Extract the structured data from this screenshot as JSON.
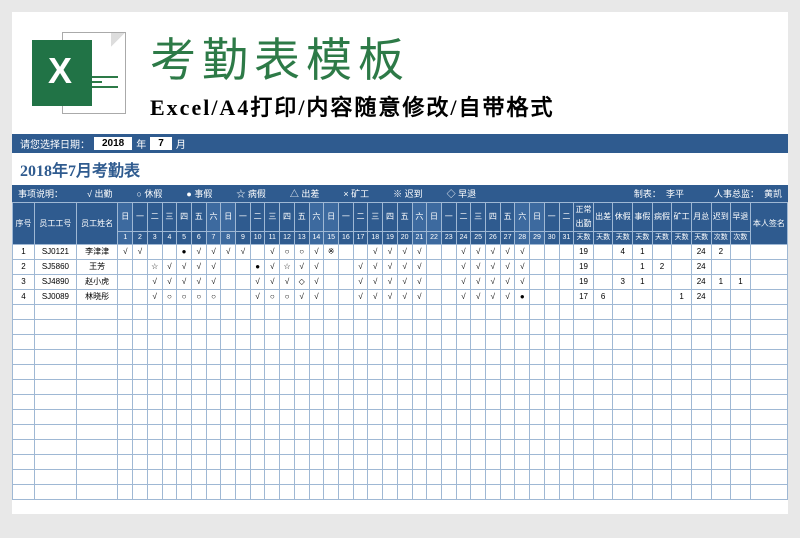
{
  "hero": {
    "big_title": "考勤表模板",
    "subtitle": "Excel/A4打印/内容随意修改/自带格式",
    "x_letter": "X"
  },
  "datebar": {
    "prompt": "请您选择日期：",
    "year": "2018",
    "year_suffix": "年",
    "month": "7",
    "month_suffix": "月"
  },
  "sheet_title": "2018年7月考勤表",
  "legend": {
    "label": "事项说明：",
    "items": [
      "√ 出勤",
      "○ 休假",
      "● 事假",
      "☆ 病假",
      "△ 出差",
      "× 矿工",
      "※ 迟到",
      "◇ 早退"
    ],
    "maker_label": "制表：",
    "maker": "李平",
    "hr_label": "人事总监：",
    "hr": "黄凯"
  },
  "headers": {
    "idx": "序号",
    "emp": "员工工号",
    "name": "员工姓名",
    "weekdays": [
      "日",
      "一",
      "二",
      "三",
      "四",
      "五",
      "六",
      "日",
      "一",
      "二",
      "三",
      "四",
      "五",
      "六",
      "日",
      "一",
      "二",
      "三",
      "四",
      "五",
      "六",
      "日",
      "一",
      "二",
      "三",
      "四",
      "五",
      "六",
      "日",
      "一",
      "二"
    ],
    "daynums": [
      "1",
      "2",
      "3",
      "4",
      "5",
      "6",
      "7",
      "8",
      "9",
      "10",
      "11",
      "12",
      "13",
      "14",
      "15",
      "16",
      "17",
      "18",
      "19",
      "20",
      "21",
      "22",
      "23",
      "24",
      "25",
      "26",
      "27",
      "28",
      "29",
      "30",
      "31"
    ],
    "stats": [
      "正常出勤",
      "出差",
      "休假",
      "事假",
      "病假",
      "矿工",
      "月总",
      "迟到",
      "早退"
    ],
    "stats2": [
      "天数",
      "天数",
      "天数",
      "天数",
      "天数",
      "天数",
      "天数",
      "次数",
      "次数"
    ],
    "sig": "本人签名"
  },
  "rows": [
    {
      "idx": "1",
      "emp": "SJ0121",
      "name": "李津津",
      "marks": [
        "√",
        "√",
        "",
        "",
        "●",
        "√",
        "√",
        "√",
        "√",
        "",
        "√",
        "○",
        "○",
        "√",
        "※",
        "",
        "",
        "√",
        "√",
        "√",
        "√",
        "",
        "",
        "√",
        "√",
        "√",
        "√",
        "√",
        "",
        "",
        ""
      ],
      "stats": [
        "19",
        "",
        "4",
        "1",
        "",
        "",
        "24",
        "2",
        ""
      ]
    },
    {
      "idx": "2",
      "emp": "SJ5860",
      "name": "王芳",
      "marks": [
        "",
        "",
        "☆",
        "√",
        "√",
        "√",
        "√",
        "",
        "",
        "●",
        "√",
        "☆",
        "√",
        "√",
        "",
        "",
        "√",
        "√",
        "√",
        "√",
        "√",
        "",
        "",
        "√",
        "√",
        "√",
        "√",
        "√",
        "",
        "",
        ""
      ],
      "stats": [
        "19",
        "",
        "",
        "1",
        "2",
        "",
        "24",
        "",
        ""
      ]
    },
    {
      "idx": "3",
      "emp": "SJ4890",
      "name": "赵小虎",
      "marks": [
        "",
        "",
        "√",
        "√",
        "√",
        "√",
        "√",
        "",
        "",
        "√",
        "√",
        "√",
        "◇",
        "√",
        "",
        "",
        "√",
        "√",
        "√",
        "√",
        "√",
        "",
        "",
        "√",
        "√",
        "√",
        "√",
        "√",
        "",
        "",
        ""
      ],
      "stats": [
        "19",
        "",
        "3",
        "1",
        "",
        "",
        "24",
        "1",
        "1"
      ]
    },
    {
      "idx": "4",
      "emp": "SJ0089",
      "name": "林晓彤",
      "marks": [
        "",
        "",
        "√",
        "○",
        "○",
        "○",
        "○",
        "",
        "",
        "√",
        "○",
        "○",
        "√",
        "√",
        "",
        "",
        "√",
        "√",
        "√",
        "√",
        "√",
        "",
        "",
        "√",
        "√",
        "√",
        "√",
        "●",
        "",
        "",
        ""
      ],
      "stats": [
        "17",
        "6",
        "",
        "",
        "",
        "1",
        "24",
        "",
        ""
      ]
    }
  ],
  "empty_row_count": 13
}
